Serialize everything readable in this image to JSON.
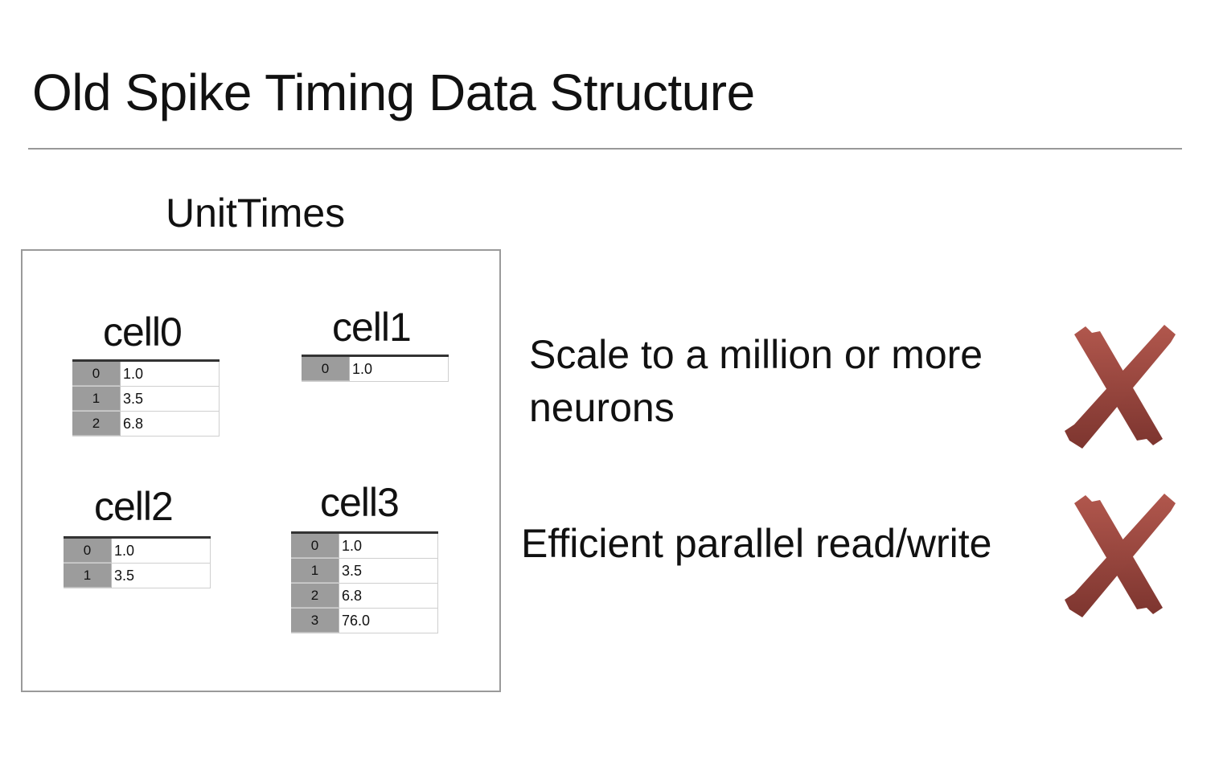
{
  "slide": {
    "title": "Old Spike Timing Data Structure",
    "structure_label": "UnitTimes",
    "cells": [
      {
        "name": "cell0",
        "rows": [
          {
            "index": "0",
            "value": "1.0"
          },
          {
            "index": "1",
            "value": "3.5"
          },
          {
            "index": "2",
            "value": "6.8"
          }
        ]
      },
      {
        "name": "cell1",
        "rows": [
          {
            "index": "0",
            "value": "1.0"
          }
        ]
      },
      {
        "name": "cell2",
        "rows": [
          {
            "index": "0",
            "value": "1.0"
          },
          {
            "index": "1",
            "value": "3.5"
          }
        ]
      },
      {
        "name": "cell3",
        "rows": [
          {
            "index": "0",
            "value": "1.0"
          },
          {
            "index": "1",
            "value": "3.5"
          },
          {
            "index": "2",
            "value": "6.8"
          },
          {
            "index": "3",
            "value": "76.0"
          }
        ]
      }
    ],
    "claims": [
      {
        "line1": "Scale to a million or more",
        "line2": "neurons",
        "status_icon": "x-mark-icon"
      },
      {
        "line1": "Efficient parallel read/write",
        "line2": "",
        "status_icon": "x-mark-icon"
      }
    ],
    "colors": {
      "x_mark": "#8e3f37",
      "x_mark_light": "#b1574d",
      "table_index_bg": "#9c9c9c",
      "rule": "#999999"
    }
  }
}
